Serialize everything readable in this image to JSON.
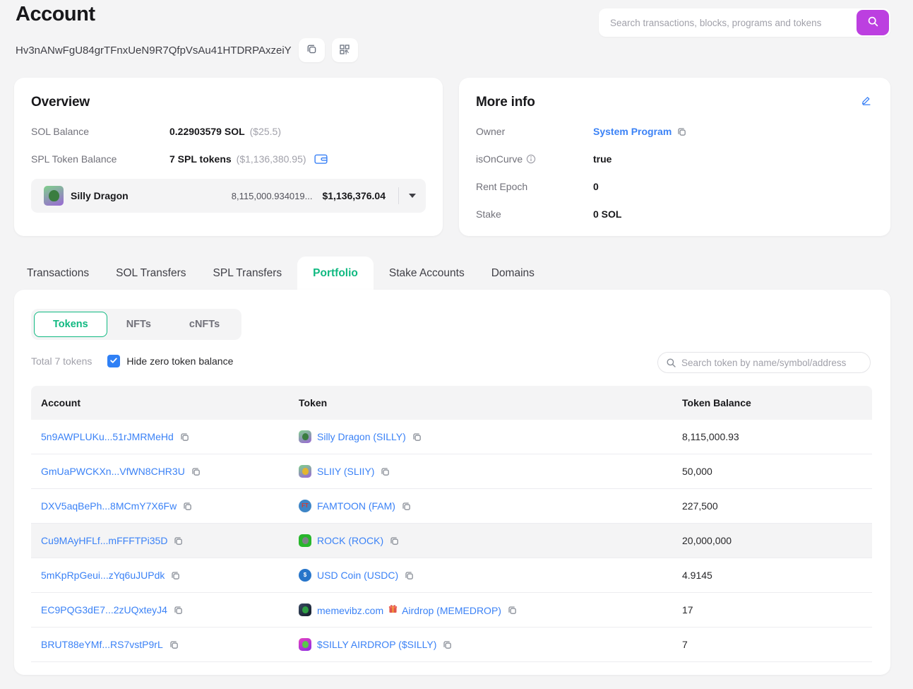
{
  "page": {
    "title": "Account",
    "address": "Hv3nANwFgU84grTFnxUeN9R7QfpVsAu41HTDRPAxzeiY",
    "search_placeholder": "Search transactions, blocks, programs and tokens"
  },
  "colors": {
    "accent_purple": "#bc3fe0",
    "link_blue": "#3b82f6",
    "active_green": "#10b981",
    "checkbox_blue": "#2f80f5",
    "page_bg": "#f4f4f5"
  },
  "overview": {
    "title": "Overview",
    "rows": [
      {
        "label": "SOL Balance",
        "value": "0.22903579 SOL",
        "sub": "($25.5)"
      },
      {
        "label": "SPL Token Balance",
        "value": "7 SPL tokens",
        "sub": "($1,136,380.95)",
        "wallet_icon": true
      }
    ],
    "token_selector": {
      "name": "Silly Dragon",
      "amount": "8,115,000.934019...",
      "usd": "$1,136,376.04",
      "icon": "silly-dragon"
    }
  },
  "more_info": {
    "title": "More info",
    "rows": [
      {
        "label": "Owner",
        "value": "System Program",
        "link": true,
        "copy": true
      },
      {
        "label": "isOnCurve",
        "info_icon": true,
        "value": "true"
      },
      {
        "label": "Rent Epoch",
        "value": "0"
      },
      {
        "label": "Stake",
        "value": "0 SOL"
      }
    ]
  },
  "tabs": [
    {
      "label": "Transactions",
      "active": false
    },
    {
      "label": "SOL Transfers",
      "active": false
    },
    {
      "label": "SPL Transfers",
      "active": false
    },
    {
      "label": "Portfolio",
      "active": true
    },
    {
      "label": "Stake Accounts",
      "active": false
    },
    {
      "label": "Domains",
      "active": false
    }
  ],
  "portfolio": {
    "subtabs": [
      {
        "label": "Tokens",
        "active": true
      },
      {
        "label": "NFTs",
        "active": false
      },
      {
        "label": "cNFTs",
        "active": false
      }
    ],
    "total_text": "Total 7 tokens",
    "hide_zero_label": "Hide zero token balance",
    "hide_zero_checked": true,
    "token_search_placeholder": "Search token by name/symbol/address",
    "table": {
      "columns": [
        "Account",
        "Token",
        "Token Balance"
      ],
      "rows": [
        {
          "account": "5n9AWPLUKu...51rJMRMeHd",
          "token": "Silly Dragon (SILLY)",
          "icon": "silly-dragon",
          "balance": "8,115,000.93",
          "highlighted": false
        },
        {
          "account": "GmUaPWCKXn...VfWN8CHR3U",
          "token": "SLIIY (SLIIY)",
          "icon": "sliiy",
          "balance": "50,000",
          "highlighted": false
        },
        {
          "account": "DXV5aqBePh...8MCmY7X6Fw",
          "token": "FAMTOON (FAM)",
          "icon": "famtoon",
          "balance": "227,500",
          "highlighted": false
        },
        {
          "account": "Cu9MAyHFLf...mFFFTPi35D",
          "token": "ROCK (ROCK)",
          "icon": "rock",
          "balance": "20,000,000",
          "highlighted": true
        },
        {
          "account": "5mKpRpGeui...zYq6uJUPdk",
          "token": "USD Coin (USDC)",
          "icon": "usdc",
          "balance": "4.9145",
          "highlighted": false
        },
        {
          "account": "EC9PQG3dE7...2zUQxteyJ4",
          "token": "memevibz.com {gift} Airdrop (MEMEDROP)",
          "icon": "memedrop",
          "balance": "17",
          "highlighted": false
        },
        {
          "account": "BRUT88eYMf...RS7vstP9rL",
          "token": "$SILLY AIRDROP ($SILLY)",
          "icon": "silly-airdrop",
          "balance": "7",
          "highlighted": false
        }
      ]
    }
  },
  "token_icons": {
    "silly-dragon": {
      "shape": "rounded",
      "bg": "linear-gradient(160deg,#7fd08b 0%,#9a68d5 100%)",
      "dot": "#3a7d3f"
    },
    "sliiy": {
      "shape": "rounded",
      "bg": "linear-gradient(160deg,#7fd08b 0%,#9a68d5 100%)",
      "dot": "#e3b52e"
    },
    "famtoon": {
      "shape": "circle",
      "bg": "#3d85c6",
      "label": "FT",
      "label_color": "#d63a2f"
    },
    "rock": {
      "shape": "rounded",
      "bg": "#28b62c",
      "dot": "#7d8287"
    },
    "usdc": {
      "shape": "circle",
      "bg": "#2775ca",
      "label": "$",
      "label_color": "#ffffff"
    },
    "memedrop": {
      "shape": "rounded",
      "bg": "linear-gradient(135deg,#3a4a63 0%,#131b28 100%)",
      "dot": "#2f9e44"
    },
    "silly-airdrop": {
      "shape": "rounded",
      "bg": "linear-gradient(150deg,#e743c0 0%,#8a2be2 100%)",
      "dot": "#58c84b"
    }
  }
}
